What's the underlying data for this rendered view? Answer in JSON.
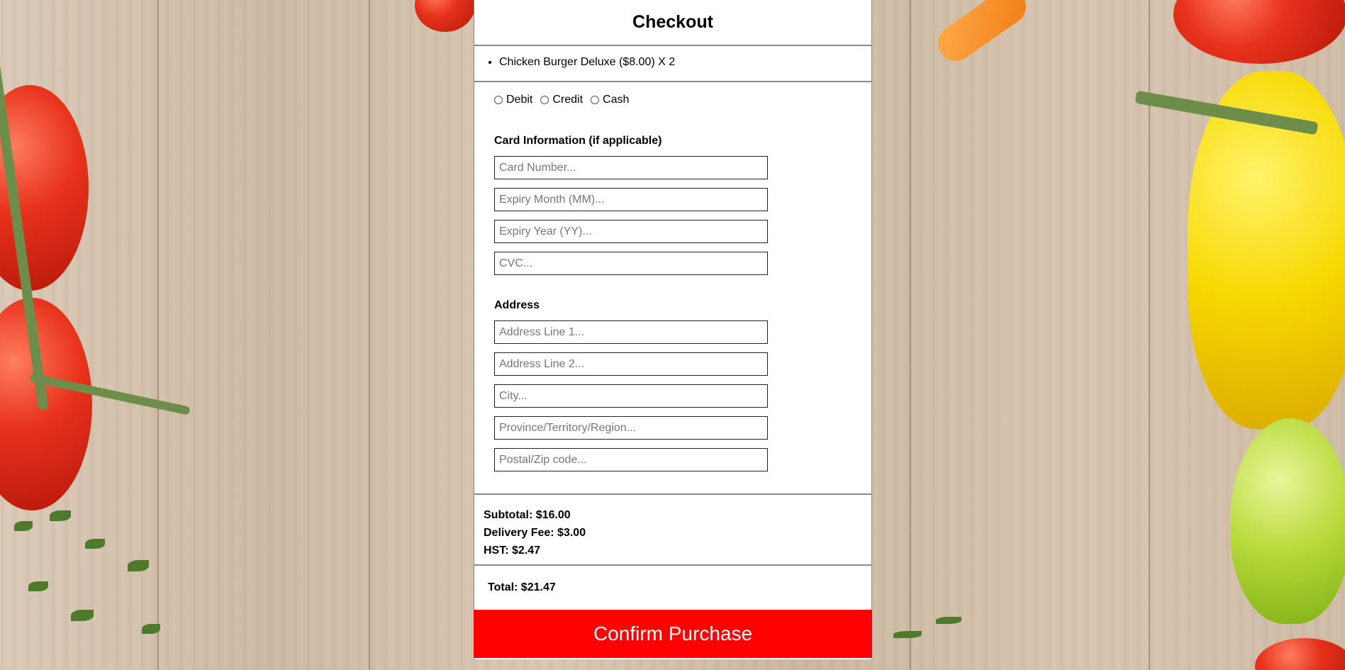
{
  "checkout": {
    "title": "Checkout",
    "items": [
      "Chicken Burger Deluxe ($8.00) X 2"
    ],
    "payment_methods": [
      "Debit",
      "Credit",
      "Cash"
    ],
    "card_section_title": "Card Information (if applicable)",
    "card_fields": {
      "card_number": "Card Number...",
      "expiry_month": "Expiry Month (MM)...",
      "expiry_year": "Expiry Year (YY)...",
      "cvc": "CVC..."
    },
    "address_section_title": "Address",
    "address_fields": {
      "line1": "Address Line 1...",
      "line2": "Address Line 2...",
      "city": "City...",
      "region": "Province/Territory/Region...",
      "postal": "Postal/Zip code..."
    },
    "subtotal": "Subtotal: $16.00",
    "delivery_fee": "Delivery Fee: $3.00",
    "hst": "HST: $2.47",
    "total": "Total: $21.47",
    "confirm_label": "Confirm Purchase"
  },
  "colors": {
    "confirm_button": "#ff0000",
    "panel_border": "#8a8a8a"
  }
}
